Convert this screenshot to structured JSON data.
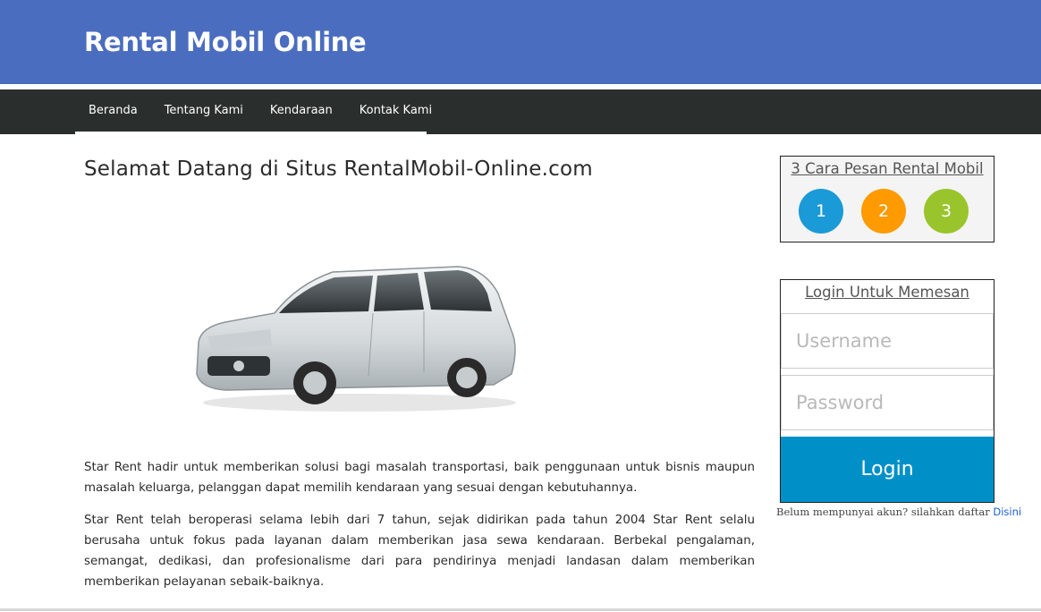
{
  "header": {
    "title": "Rental Mobil Online"
  },
  "nav": {
    "items": [
      {
        "label": "Beranda"
      },
      {
        "label": "Tentang Kami"
      },
      {
        "label": "Kendaraan"
      },
      {
        "label": "Kontak Kami"
      }
    ]
  },
  "main": {
    "title": "Selamat Datang di Situs RentalMobil-Online.com",
    "paragraphs": [
      "Star Rent hadir untuk memberikan solusi bagi masalah transportasi, baik penggunaan untuk bisnis maupun masalah keluarga, pelanggan dapat memilih kendaraan yang sesuai dengan kebutuhannya.",
      "Star Rent telah beroperasi selama lebih dari 7 tahun, sejak didirikan pada tahun 2004 Star Rent selalu berusaha untuk fokus pada layanan dalam memberikan jasa sewa kendaraan. Berbekal pengalaman, semangat, dedikasi, dan profesionalisme dari para pendirinya menjadi landasan dalam memberikan memberikan pelayanan sebaik-baiknya."
    ]
  },
  "sidebar": {
    "order_steps": {
      "title": "3 Cara Pesan Rental Mobil",
      "steps": [
        "1",
        "2",
        "3"
      ]
    },
    "login": {
      "title": "Login Untuk Memesan",
      "username_placeholder": "Username",
      "password_placeholder": "Password",
      "button_label": "Login",
      "register_text": "Belum mempunyai akun? silahkan daftar",
      "register_link": "Disini"
    }
  },
  "colors": {
    "header": "#4a6dbf",
    "nav": "#2a2e2c",
    "login_button": "#0090c8",
    "step1": "#1a9ad6",
    "step2": "#ff9a00",
    "step3": "#9ac42c"
  },
  "images": {
    "hero": "silver-mpv-car-photo"
  }
}
